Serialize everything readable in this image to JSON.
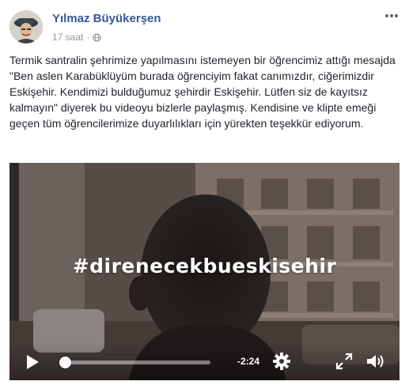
{
  "post": {
    "author_name": "Yılmaz Büyükerşen",
    "timestamp": "17 saat",
    "separator": "·",
    "privacy_icon": "globe-icon",
    "more_icon": "more-options-icon",
    "text": "Termik santralin şehrimize yapılmasını istemeyen bir öğrencimiz attığı mesajda \"Ben aslen Karabüklüyüm burada öğrenciyim fakat canımızdır, ciğerimizdir Eskişehir. Kendimizi bulduğumuz şehirdir Eskişehir. Lütfen siz de kayıtsız kalmayın\" diyerek bu videoyu bizlerle paylaşmış. Kendisine ve klipte emeği geçen tüm öğrencilerimize duyarlılıkları için yürekten teşekkür ediyorum."
  },
  "video": {
    "overlay_text": "#direnecekbueskisehir",
    "time_remaining": "-2:24",
    "progress": 0.02,
    "icons": {
      "play": "play-icon",
      "settings": "gear-icon",
      "fullscreen": "fullscreen-icon",
      "volume": "volume-icon"
    }
  }
}
